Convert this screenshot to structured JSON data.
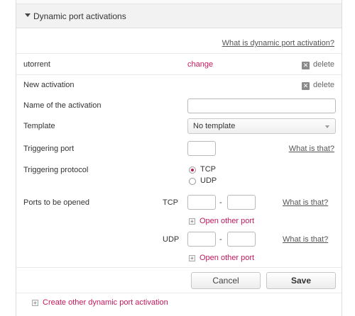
{
  "panel": {
    "title": "Dynamic port activations",
    "help_link": "What is dynamic port activation?"
  },
  "activations": [
    {
      "name": "utorrent",
      "change_label": "change",
      "delete_label": "delete"
    }
  ],
  "new_activation": {
    "title": "New activation",
    "delete_label": "delete",
    "name_label": "Name of the activation",
    "name_value": "",
    "template_label": "Template",
    "template_value": "No template",
    "trigger_port_label": "Triggering port",
    "trigger_port_value": "",
    "trigger_port_help": "What is that?",
    "protocol_label": "Triggering protocol",
    "protocol_options": [
      "TCP",
      "UDP"
    ],
    "protocol_selected": "TCP",
    "ports_label": "Ports to be opened",
    "tcp": {
      "label": "TCP",
      "from": "",
      "to": "",
      "separator": "-",
      "help": "What is that?",
      "add_label": "Open other port"
    },
    "udp": {
      "label": "UDP",
      "from": "",
      "to": "",
      "separator": "-",
      "help": "What is that?",
      "add_label": "Open other port"
    }
  },
  "actions": {
    "cancel_label": "Cancel",
    "save_label": "Save"
  },
  "footer": {
    "create_label": "Create other dynamic port activation"
  },
  "colors": {
    "accent": "#c2185b",
    "header_bg": "#f2f2f2"
  },
  "icons": {
    "collapse": "triangle-down-icon",
    "delete": "delete-box-icon",
    "plus": "plus-box-icon",
    "dropdown": "chevron-down-icon"
  }
}
